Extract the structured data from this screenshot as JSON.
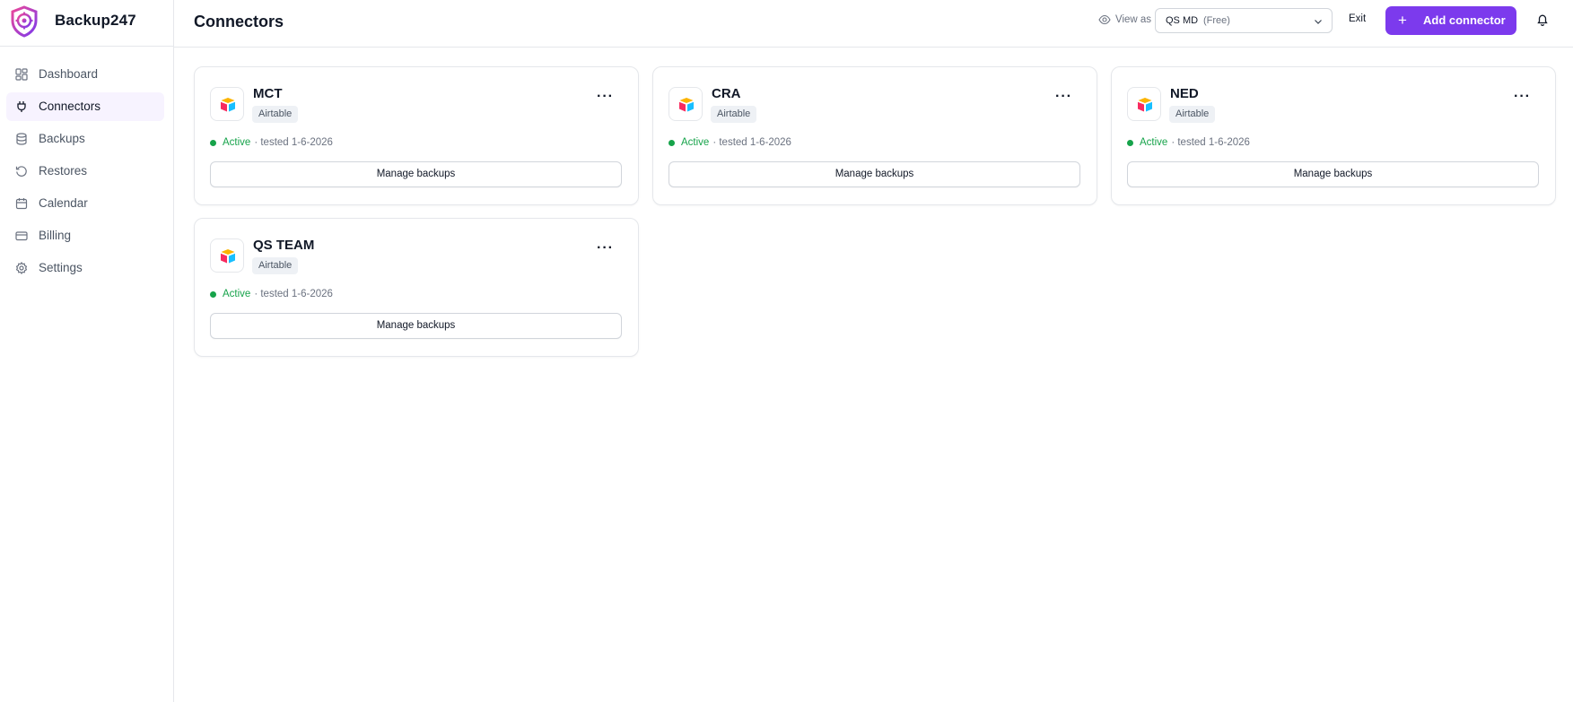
{
  "app": {
    "name": "Backup247",
    "accent_color": "#7c3aed",
    "logo_icon": "shield-gear-logo"
  },
  "sidebar": {
    "items": [
      {
        "label": "Dashboard",
        "icon": "dashboard-icon",
        "active": false
      },
      {
        "label": "Connectors",
        "icon": "plug-icon",
        "active": true
      },
      {
        "label": "Backups",
        "icon": "database-icon",
        "active": false
      },
      {
        "label": "Restores",
        "icon": "restore-icon",
        "active": false
      },
      {
        "label": "Calendar",
        "icon": "calendar-icon",
        "active": false
      },
      {
        "label": "Billing",
        "icon": "credit-card-icon",
        "active": false
      },
      {
        "label": "Settings",
        "icon": "gear-icon",
        "active": false
      }
    ]
  },
  "header": {
    "title": "Connectors",
    "view_as_label": "View as",
    "view_as_select": {
      "value": "QS MD",
      "plan": "(Free)"
    },
    "exit_label": "Exit",
    "add_button_label": "Add connector"
  },
  "connectors": [
    {
      "name": "MCT",
      "type": "Airtable",
      "status": "Active",
      "tested": "· tested 1-6-2026",
      "button": "Manage backups"
    },
    {
      "name": "CRA",
      "type": "Airtable",
      "status": "Active",
      "tested": "· tested 1-6-2026",
      "button": "Manage backups"
    },
    {
      "name": "NED",
      "type": "Airtable",
      "status": "Active",
      "tested": "· tested 1-6-2026",
      "button": "Manage backups"
    },
    {
      "name": "QS TEAM",
      "type": "Airtable",
      "status": "Active",
      "tested": "· tested 1-6-2026",
      "button": "Manage backups"
    }
  ],
  "colors": {
    "status_active": "#16a34a",
    "airtable_yellow": "#fcb400",
    "airtable_red": "#f82b60",
    "airtable_blue": "#18bfff"
  }
}
